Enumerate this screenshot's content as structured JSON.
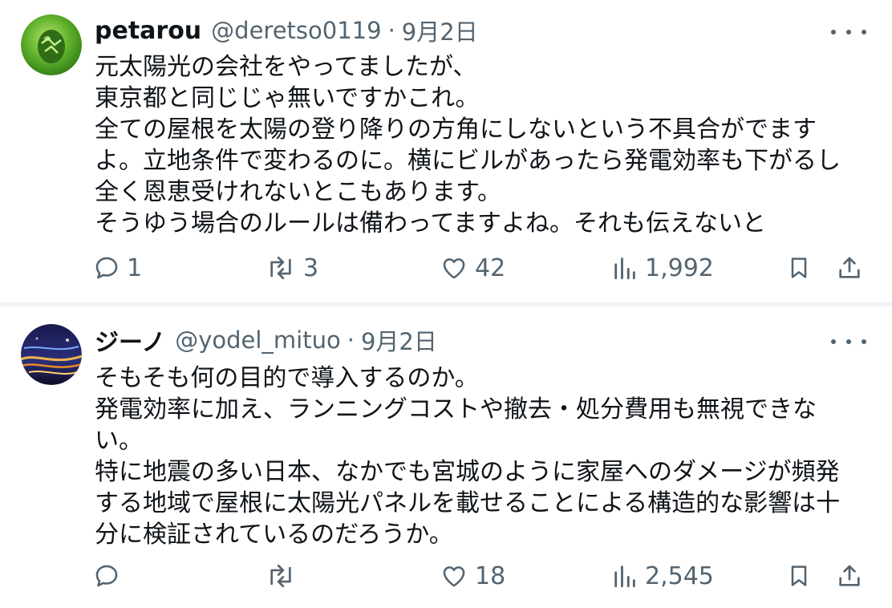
{
  "tweets": [
    {
      "name": "petarou",
      "handle": "@deretso0119",
      "date": "9月2日",
      "lines": [
        "元太陽光の会社をやってましたが、",
        "東京都と同じじゃ無いですかこれ。",
        "全ての屋根を太陽の登り降りの方角にしないという不具合がでます",
        "よ。立地条件で変わるのに。横にビルがあったら発電効率も下がるし",
        "全く恩恵受けれないとこもあります。",
        "そうゆう場合のルールは備わってますよね。それも伝えないと"
      ],
      "actions": {
        "replies": "1",
        "reposts": "3",
        "likes": "42",
        "views": "1,992"
      },
      "avatar_icon": "green-egg-avatar-icon"
    },
    {
      "name": "ジーノ",
      "handle": "@yodel_mituo",
      "date": "9月2日",
      "lines": [
        "そもそも何の目的で導入するのか。",
        "発電効率に加え、ランニングコストや撤去・処分費用も無視できな",
        "い。",
        "特に地震の多い日本、なかでも宮城のように家屋へのダメージが頻発",
        "する地域で屋根に太陽光パネルを載せることによる構造的な影響は十",
        "分に検証されているのだろうか。"
      ],
      "actions": {
        "replies": "",
        "reposts": "",
        "likes": "18",
        "views": "2,545"
      },
      "avatar_icon": "night-highway-avatar-icon"
    }
  ],
  "colors": {
    "text": "#0f1419",
    "muted": "#536471",
    "divider": "#eff3f4"
  },
  "separator": "·"
}
